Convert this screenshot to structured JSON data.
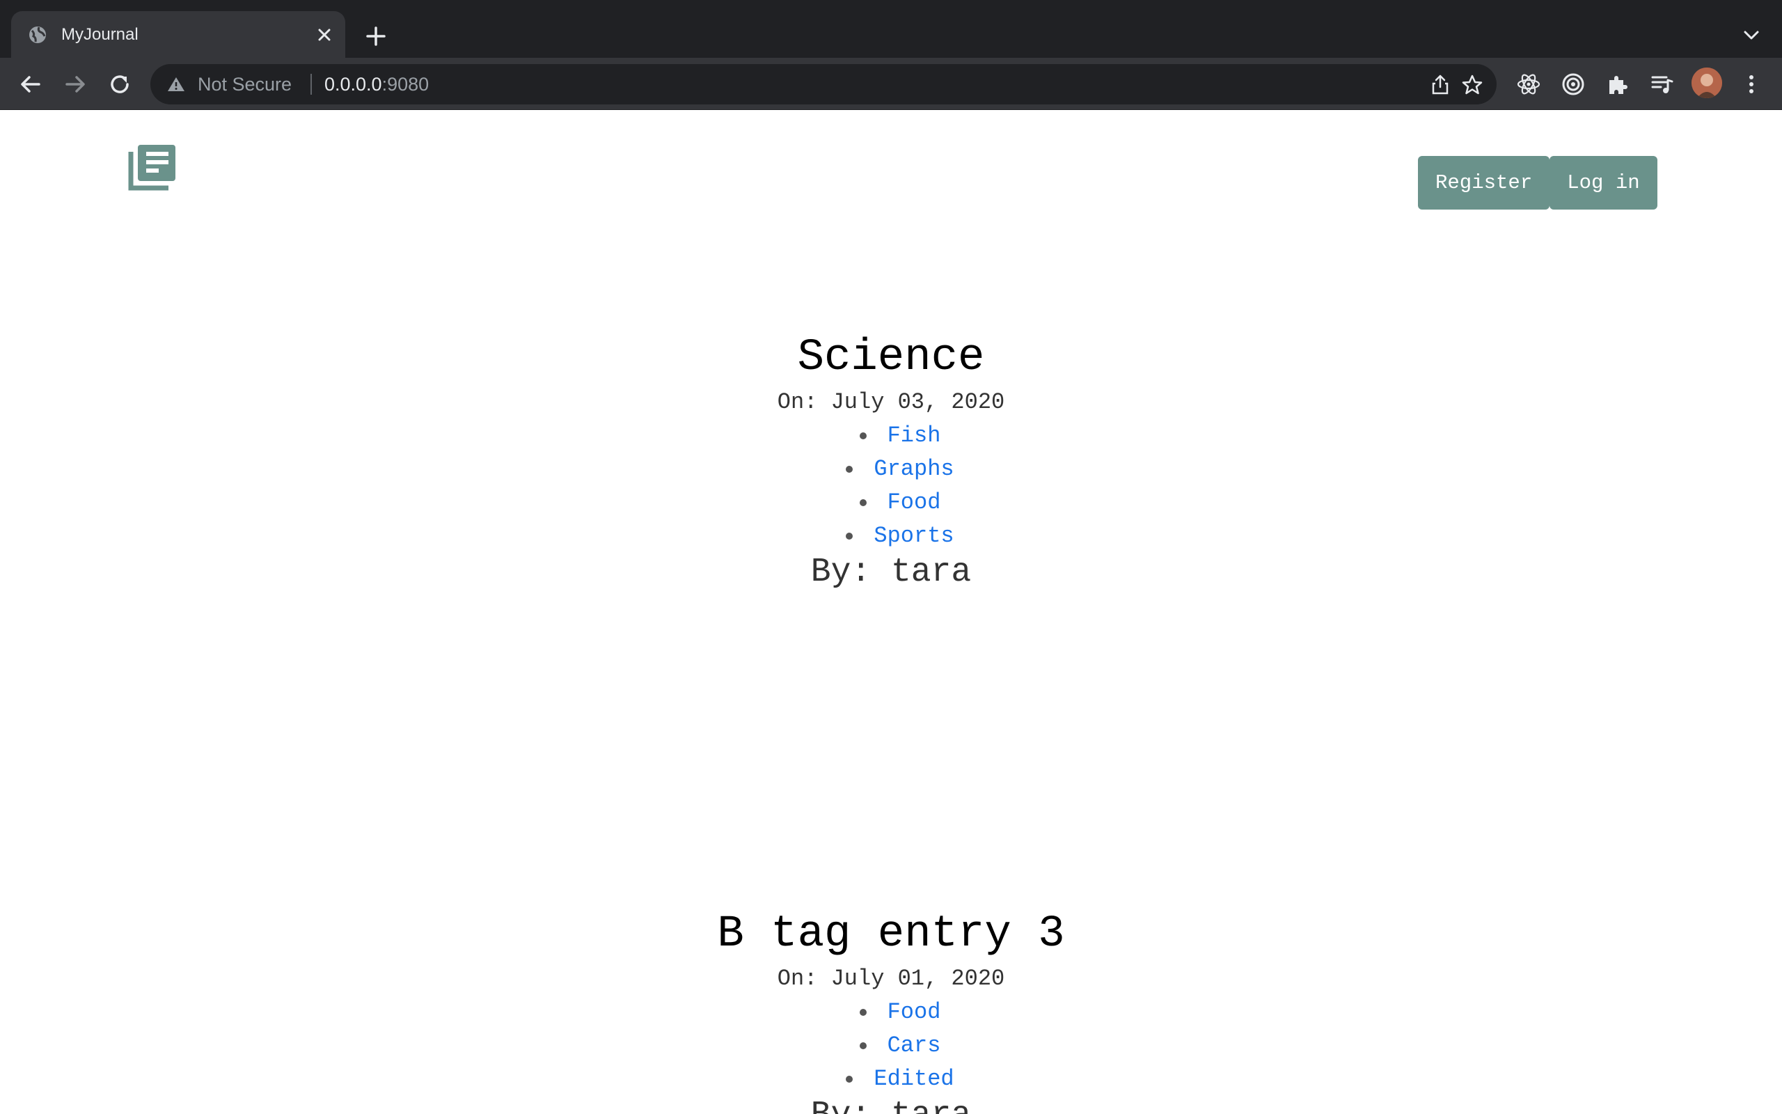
{
  "browser": {
    "tab_title": "MyJournal",
    "security_label": "Not Secure",
    "url_host": "0.0.0.0",
    "url_port": ":9080"
  },
  "header": {
    "register_label": "Register",
    "login_label": "Log in"
  },
  "entries": [
    {
      "title": "Science",
      "date": "On: July 03, 2020",
      "tags": [
        "Fish",
        "Graphs",
        "Food",
        "Sports"
      ],
      "author": "By: tara"
    },
    {
      "title": "B tag entry 3",
      "date": "On: July 01, 2020",
      "tags": [
        "Food",
        "Cars",
        "Edited"
      ],
      "author": "By: tara"
    }
  ],
  "colors": {
    "accent": "#6a928b",
    "link": "#1a73e8"
  }
}
